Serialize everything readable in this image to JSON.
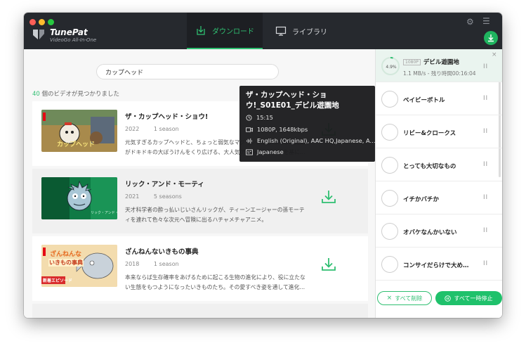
{
  "app": {
    "brand_name": "TunePat",
    "brand_sub": "VideoGo All-In-One"
  },
  "tabs": [
    {
      "label": "ダウンロード",
      "active": true
    },
    {
      "label": "ライブラリ",
      "active": false
    }
  ],
  "colors": {
    "accent": "#2fbf71",
    "titlebar": "#26292e"
  },
  "search": {
    "value": "カップヘッド"
  },
  "results": {
    "count": "40",
    "count_suffix": " 個のビデオが見つかりました",
    "items": [
      {
        "title": "ザ・カップヘッド・ショウ!",
        "year": "2022",
        "seasons": "1 season",
        "desc": "元気すぎるカップヘッドと、ちょっと弱気なマグマン。息ぴったりの兄弟がドキドキの大ぼうけんをくり広げる、大人気アクションゲームを基に…"
      },
      {
        "title": "リック・アンド・モーティ",
        "year": "2021",
        "seasons": "5 seasons",
        "desc": "天才科学者の酔っ払いじいさんリックが、ティーンエージャーの孫モーティを連れて色々な次元へ冒険に出るハチャメチャアニメ。"
      },
      {
        "title": "ざんねんないきもの事典",
        "year": "2018",
        "seasons": "1 season",
        "desc": "本来ならば生存確率をあげるために起こる生物の進化により、役に立たない生態をもつようになったいきものたち。その愛すべき姿を通して進化…",
        "thumb_caption": "新着エピソード",
        "thumb_title_a": "ざんねんな",
        "thumb_title_b": "いきもの事典"
      }
    ]
  },
  "popup": {
    "title": "ザ・カップヘッド・ショウ!_S01E01_デビル遊園地",
    "duration": "15:15",
    "quality": "1080P, 1648kbps",
    "audio": "English (Original), AAC HQ,Japanese, A...",
    "subtitle": "Japanese"
  },
  "queue": {
    "active": {
      "badge": "1080P",
      "title": "デビル遊園地",
      "progress_percent": 4.9,
      "progress_text": "4.9%",
      "speed": "1.1 MB/s - 残り時間00:16:04"
    },
    "items": [
      "ベイビーボトル",
      "リビー&クロークス",
      "とっても大切なもの",
      "イチかバチか",
      "オバケなんかいない",
      "コンサイだらけで大め…"
    ],
    "pause_glyph": "I I",
    "close_glyph": "×"
  },
  "footer": {
    "delete_all": "すべて削除",
    "pause_all": "すべて一時停止"
  }
}
